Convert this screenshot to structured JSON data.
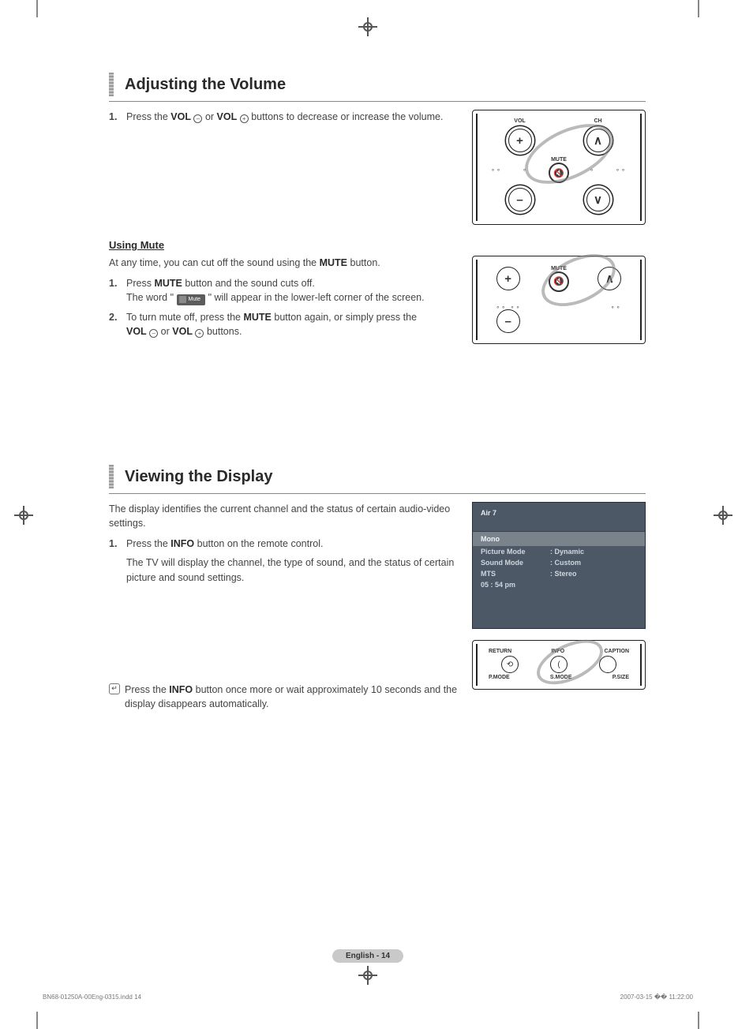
{
  "section1": {
    "title": "Adjusting the Volume",
    "step1_pre": "Press the ",
    "step1_vol": "VOL",
    "step1_mid": " or ",
    "step1_post": " buttons to decrease or increase the volume.",
    "mute_heading": "Using Mute",
    "mute_intro_a": "At any time, you can cut off the sound using the ",
    "mute_intro_b": "MUTE",
    "mute_intro_c": " button.",
    "m1a": "Press ",
    "m1b": "MUTE",
    "m1c": " button and the sound cuts off.",
    "m1d": "The word \"",
    "m1e": "\" will appear in the lower-left corner of the screen.",
    "m2a": "To turn mute off, press the ",
    "m2b": "MUTE",
    "m2c": " button again, or simply press the ",
    "m2d": "VOL",
    "m2e": " or ",
    "m2f": "VOL",
    "m2g": "  buttons.",
    "mute_chip": "Mute",
    "remote": {
      "vol": "VOL",
      "ch": "CH",
      "mute": "MUTE"
    }
  },
  "section2": {
    "title": "Viewing the Display",
    "intro": "The display identifies the current channel and the status of certain audio-video settings.",
    "s1a": "Press the ",
    "s1b": "INFO",
    "s1c": " button on the remote control.",
    "s1d": "The TV will display the channel, the type of sound, and the status of certain picture and sound settings.",
    "note_a": "Press the ",
    "note_b": "INFO",
    "note_c": " button once more or wait approximately 10 seconds and the display disappears automatically.",
    "osd": {
      "channel": "Air  7",
      "mono": "Mono",
      "rows": [
        {
          "k": "Picture Mode",
          "v": ": Dynamic"
        },
        {
          "k": "Sound Mode",
          "v": ": Custom"
        },
        {
          "k": "MTS",
          "v": ": Stereo"
        }
      ],
      "time": "05 : 54 pm"
    },
    "remote2": {
      "top": [
        "RETURN",
        "INFO",
        "CAPTION"
      ],
      "bottom": [
        "P.MODE",
        "S.MODE",
        "",
        "P.SIZE"
      ]
    }
  },
  "page_badge": "English - 14",
  "footer": {
    "left": "BN68-01250A-00Eng-0315.indd   14",
    "right": "2007-03-15   �� 11:22:00"
  }
}
